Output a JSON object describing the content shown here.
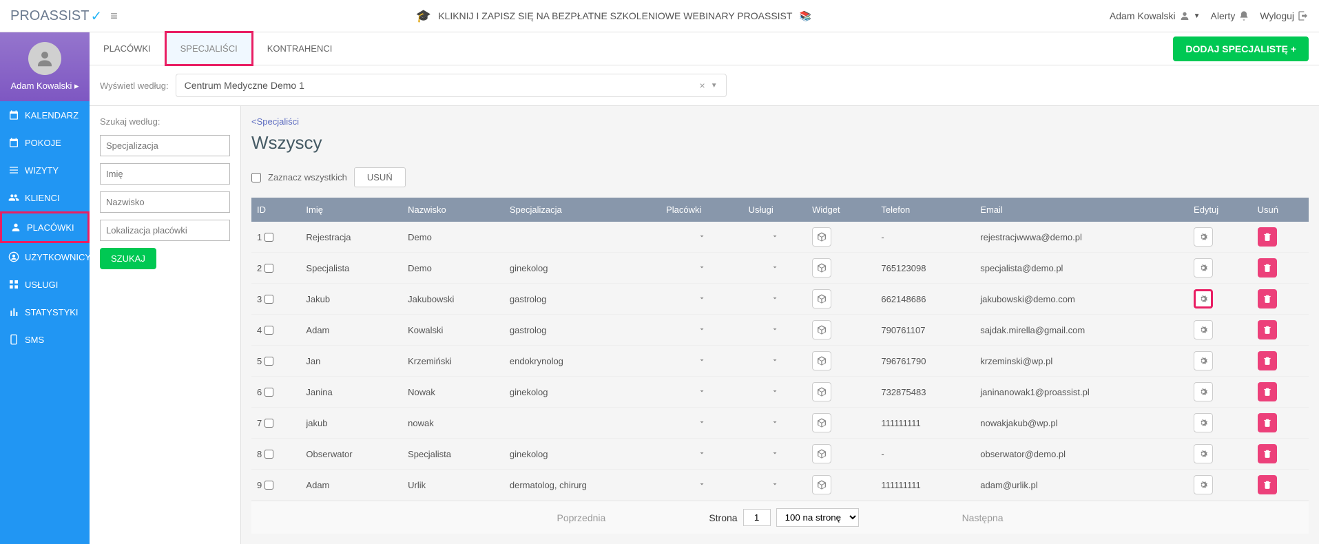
{
  "header": {
    "logo": "PROASSIST",
    "banner": "KLIKNIJ I ZAPISZ SIĘ NA BEZPŁATNE SZKOLENIOWE WEBINARY PROASSIST",
    "user": "Adam Kowalski",
    "alerts": "Alerty",
    "logout": "Wyloguj"
  },
  "sidebar": {
    "user": "Adam Kowalski",
    "items": [
      {
        "label": "KALENDARZ"
      },
      {
        "label": "POKOJE"
      },
      {
        "label": "WIZYTY"
      },
      {
        "label": "KLIENCI"
      },
      {
        "label": "PLACÓWKI"
      },
      {
        "label": "UŻYTKOWNICY"
      },
      {
        "label": "USŁUGI"
      },
      {
        "label": "STATYSTYKI"
      },
      {
        "label": "SMS"
      }
    ]
  },
  "tabs": {
    "tab0": "PLACÓWKI",
    "tab1": "SPECJALIŚCI",
    "tab2": "KONTRAHENCI",
    "add_button": "DODAJ SPECJALISTĘ +"
  },
  "filter": {
    "label": "Wyświetl według:",
    "value": "Centrum Medyczne Demo 1"
  },
  "search": {
    "label": "Szukaj według:",
    "spec_ph": "Specjalizacja",
    "imie_ph": "Imię",
    "nazwisko_ph": "Nazwisko",
    "lok_ph": "Lokalizacja placówki",
    "button": "SZUKAJ"
  },
  "breadcrumb": "<Specjaliści",
  "page_title": "Wszyscy",
  "select_all": {
    "label": "Zaznacz wszystkich",
    "delete": "USUŃ"
  },
  "columns": {
    "id": "ID",
    "imie": "Imię",
    "nazwisko": "Nazwisko",
    "spec": "Specjalizacja",
    "plac": "Placówki",
    "uslugi": "Usługi",
    "widget": "Widget",
    "tel": "Telefon",
    "email": "Email",
    "edytuj": "Edytuj",
    "usun": "Usuń"
  },
  "rows": [
    {
      "idx": "1",
      "imie": "Rejestracja",
      "nazwisko": "Demo",
      "spec": "",
      "tel": "-",
      "email": "rejestracjwwwa@demo.pl"
    },
    {
      "idx": "2",
      "imie": "Specjalista",
      "nazwisko": "Demo",
      "spec": "ginekolog",
      "tel": "765123098",
      "email": "specjalista@demo.pl"
    },
    {
      "idx": "3",
      "imie": "Jakub",
      "nazwisko": "Jakubowski",
      "spec": "gastrolog",
      "tel": "662148686",
      "email": "jakubowski@demo.com"
    },
    {
      "idx": "4",
      "imie": "Adam",
      "nazwisko": "Kowalski",
      "spec": "gastrolog",
      "tel": "790761107",
      "email": "sajdak.mirella@gmail.com"
    },
    {
      "idx": "5",
      "imie": "Jan",
      "nazwisko": "Krzemiński",
      "spec": "endokrynolog",
      "tel": "796761790",
      "email": "krzeminski@wp.pl"
    },
    {
      "idx": "6",
      "imie": "Janina",
      "nazwisko": "Nowak",
      "spec": "ginekolog",
      "tel": "732875483",
      "email": "janinanowak1@proassist.pl"
    },
    {
      "idx": "7",
      "imie": "jakub",
      "nazwisko": "nowak",
      "spec": "",
      "tel": "111111111",
      "email": "nowakjakub@wp.pl"
    },
    {
      "idx": "8",
      "imie": "Obserwator",
      "nazwisko": "Specjalista",
      "spec": "ginekolog",
      "tel": "-",
      "email": "obserwator@demo.pl"
    },
    {
      "idx": "9",
      "imie": "Adam",
      "nazwisko": "Urlik",
      "spec": "dermatolog, chirurg",
      "tel": "111111111",
      "email": "adam@urlik.pl"
    }
  ],
  "pagination": {
    "prev": "Poprzednia",
    "page_label": "Strona",
    "page": "1",
    "per_page": "100 na stronę",
    "next": "Następna"
  }
}
